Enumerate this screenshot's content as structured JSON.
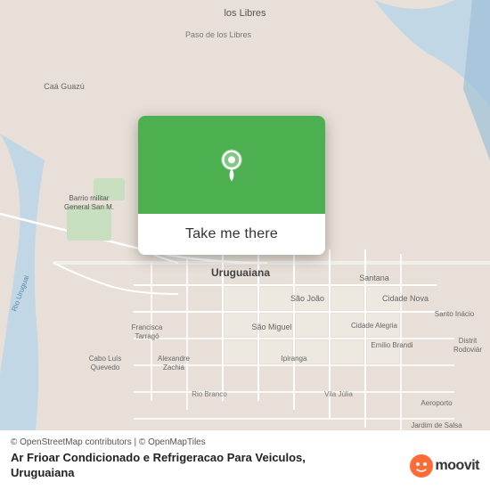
{
  "map": {
    "background_color": "#e8e0d8",
    "green_overlay_color": "#4CAF50",
    "attribution": "© OpenStreetMap contributors | © OpenMapTiles"
  },
  "card": {
    "button_label": "Take me there",
    "pin_icon": "location-pin"
  },
  "place": {
    "title": "Ar Frioar Condicionado e Refrigeracao Para Veiculos,",
    "subtitle": "Uruguaiana"
  },
  "branding": {
    "moovit_label": "moovit"
  },
  "labels": {
    "ios_libres": "los Libres",
    "paso_de_los_libres": "Paso de los Libres",
    "caaguazu": "Caá Guazú",
    "barrio_militar": "Barrio militar\nGeneral San M...",
    "uruguaiana": "Uruguaiana",
    "santana": "Santana",
    "sao_joao": "São João",
    "cidade_nova": "Cidade Nova",
    "santo_inacio": "Santo Inácio",
    "francisca_tarrago": "Francisca\nTarragó",
    "sao_miguel": "São Miguel",
    "cidade_alegria": "Cidade Alegria",
    "emilio_brandi": "Emilio Brandi",
    "distrit_rodoviario": "Distrit\nRodoviár",
    "cabo_luis_quevedo": "Cabo Luís\nQuevedo",
    "alexandre_zachia": "Alexandre\nZachia",
    "ipiranga": "Ipiranga",
    "rio_branco": "Rio Branco",
    "vila_julia": "Vila Júlia",
    "aeroporto": "Aeroporto",
    "jardim_de_salsa": "Jardim de Salsa",
    "rio_uruguai": "Rio Uruguai"
  }
}
